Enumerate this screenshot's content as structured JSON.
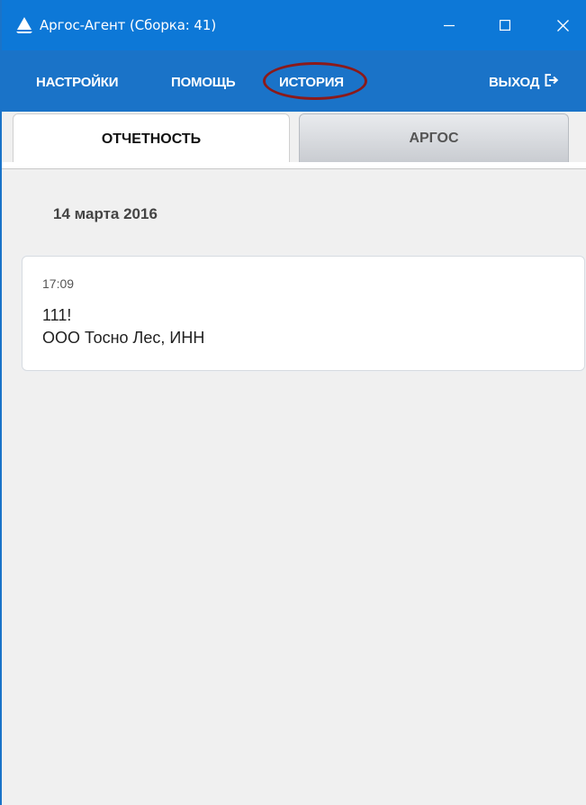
{
  "window": {
    "title": "Аргос-Агент (Сборка: 41)",
    "app_icon": "sail-icon",
    "controls": {
      "minimize_icon": "minimize-icon",
      "maximize_icon": "maximize-icon",
      "close_icon": "close-icon"
    }
  },
  "menu": {
    "settings": "НАСТРОЙКИ",
    "help": "ПОМОЩЬ",
    "history": "ИСТОРИЯ",
    "exit": "ВЫХОД",
    "exit_icon": "logout-icon",
    "history_highlight_color": "#8b1a1a"
  },
  "tabs": [
    {
      "label": "ОТЧЕТНОСТЬ",
      "active": true
    },
    {
      "label": "АРГОС",
      "active": false
    }
  ],
  "history": {
    "date": "14 марта 2016",
    "entries": [
      {
        "time": "17:09",
        "title": "111!",
        "subtitle": "ООО Тосно Лес, ИНН"
      }
    ]
  },
  "colors": {
    "titlebar": "#0d78d7",
    "menubar": "#1a73c8",
    "background": "#f0f0f0"
  }
}
